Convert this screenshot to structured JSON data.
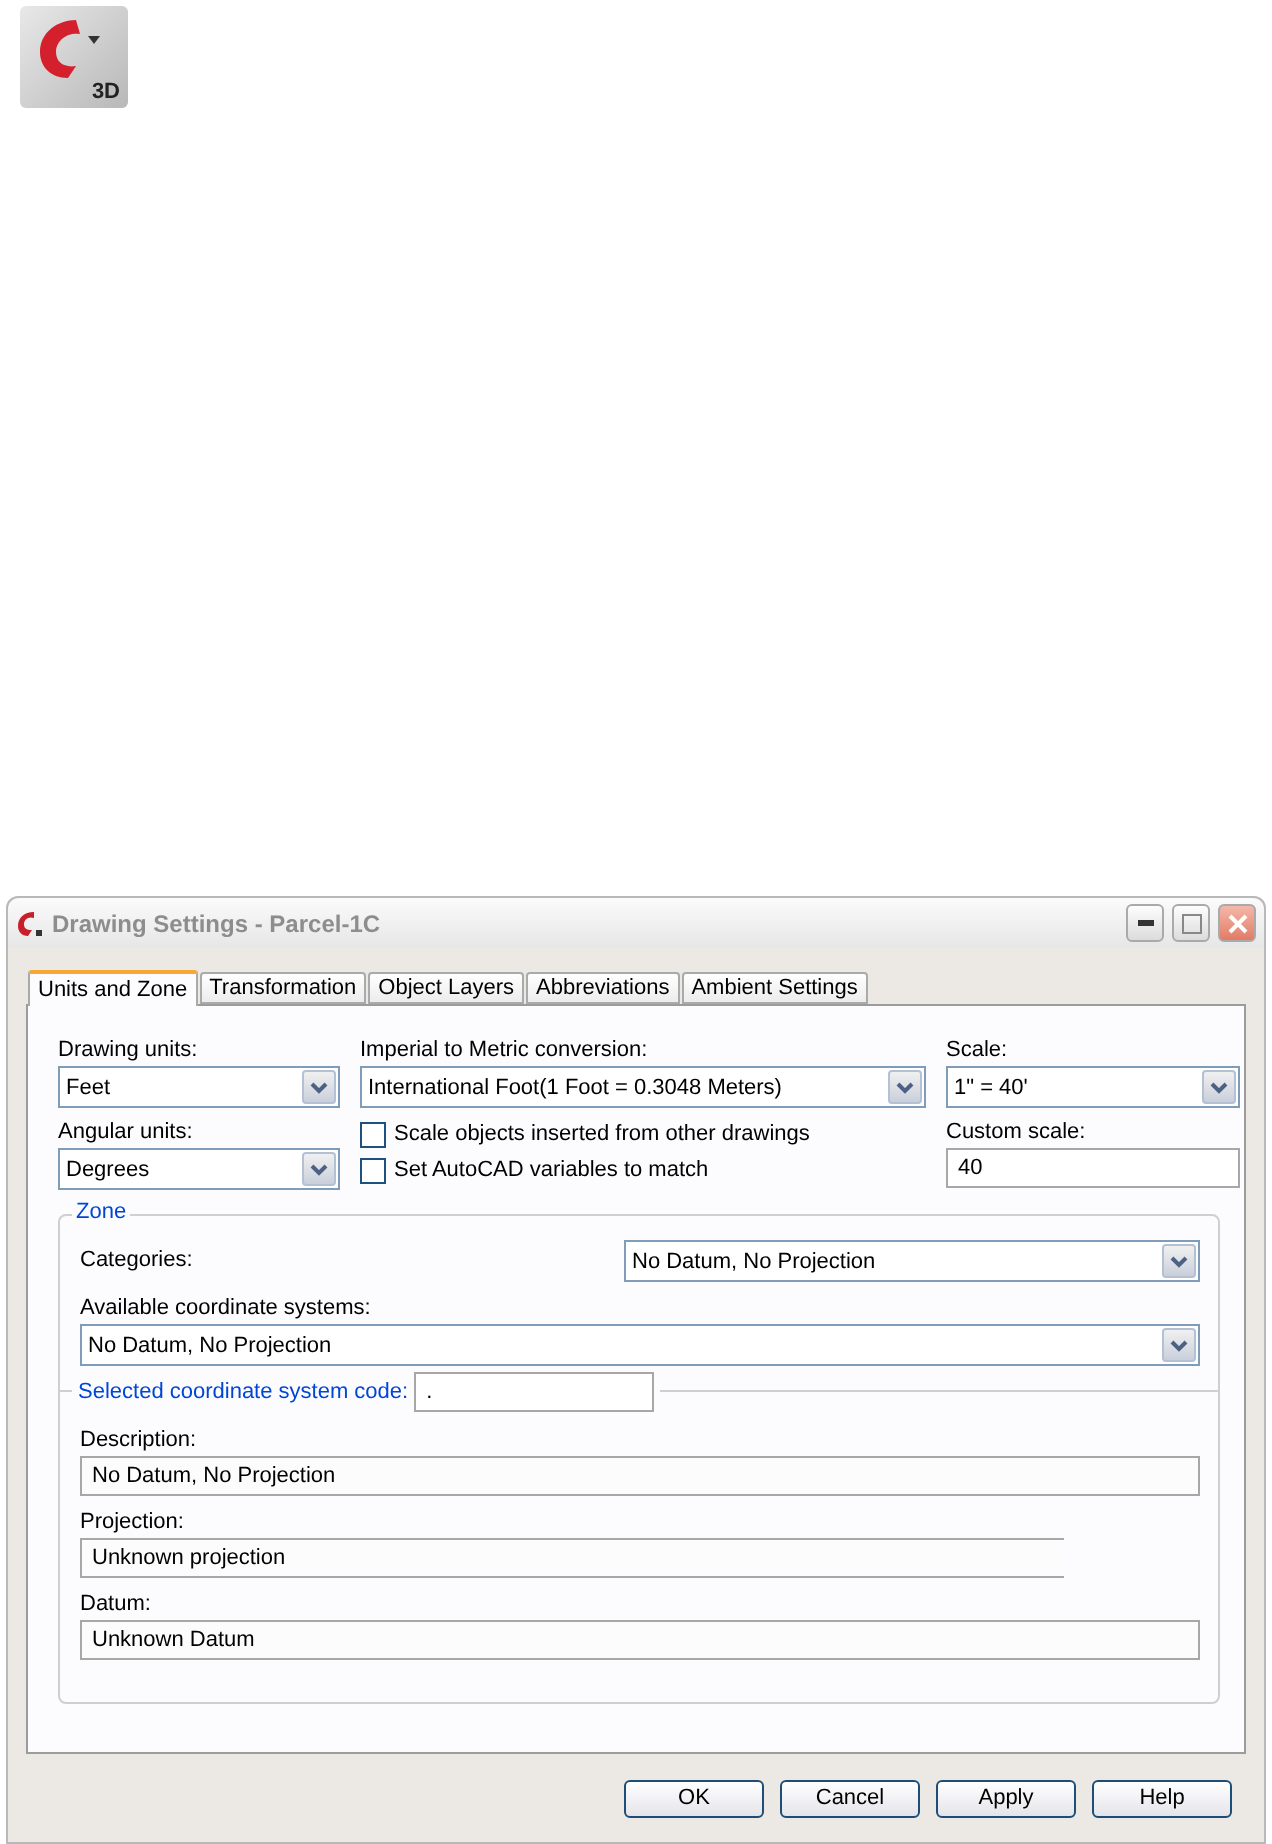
{
  "app_icon": {
    "label": "3D"
  },
  "window": {
    "title": "Drawing Settings - Parcel-1C"
  },
  "tabs": [
    {
      "label": "Units and Zone",
      "selected": true
    },
    {
      "label": "Transformation",
      "selected": false
    },
    {
      "label": "Object Layers",
      "selected": false
    },
    {
      "label": "Abbreviations",
      "selected": false
    },
    {
      "label": "Ambient Settings",
      "selected": false
    }
  ],
  "drawing_units": {
    "label": "Drawing units:",
    "value": "Feet"
  },
  "angular_units": {
    "label": "Angular units:",
    "value": "Degrees"
  },
  "imperial_to_metric": {
    "label": "Imperial to Metric conversion:",
    "value": "International Foot(1 Foot = 0.3048 Meters)"
  },
  "checkboxes": [
    {
      "label": "Scale objects inserted from other drawings",
      "checked": false
    },
    {
      "label": "Set AutoCAD variables to match",
      "checked": false
    }
  ],
  "scale": {
    "label": "Scale:",
    "value": "1\" = 40'"
  },
  "custom_scale": {
    "label": "Custom scale:",
    "value": "40"
  },
  "zone": {
    "title": "Zone",
    "categories": {
      "label": "Categories:",
      "value": "No Datum, No Projection"
    },
    "available": {
      "label": "Available coordinate systems:",
      "value": "No Datum, No Projection"
    },
    "selected_code": {
      "label": "Selected coordinate system code:",
      "value": "."
    },
    "description": {
      "label": "Description:",
      "value": "No Datum, No Projection"
    },
    "projection": {
      "label": "Projection:",
      "value": "Unknown projection"
    },
    "datum": {
      "label": "Datum:",
      "value": "Unknown Datum"
    }
  },
  "buttons": [
    "OK",
    "Cancel",
    "Apply",
    "Help"
  ]
}
